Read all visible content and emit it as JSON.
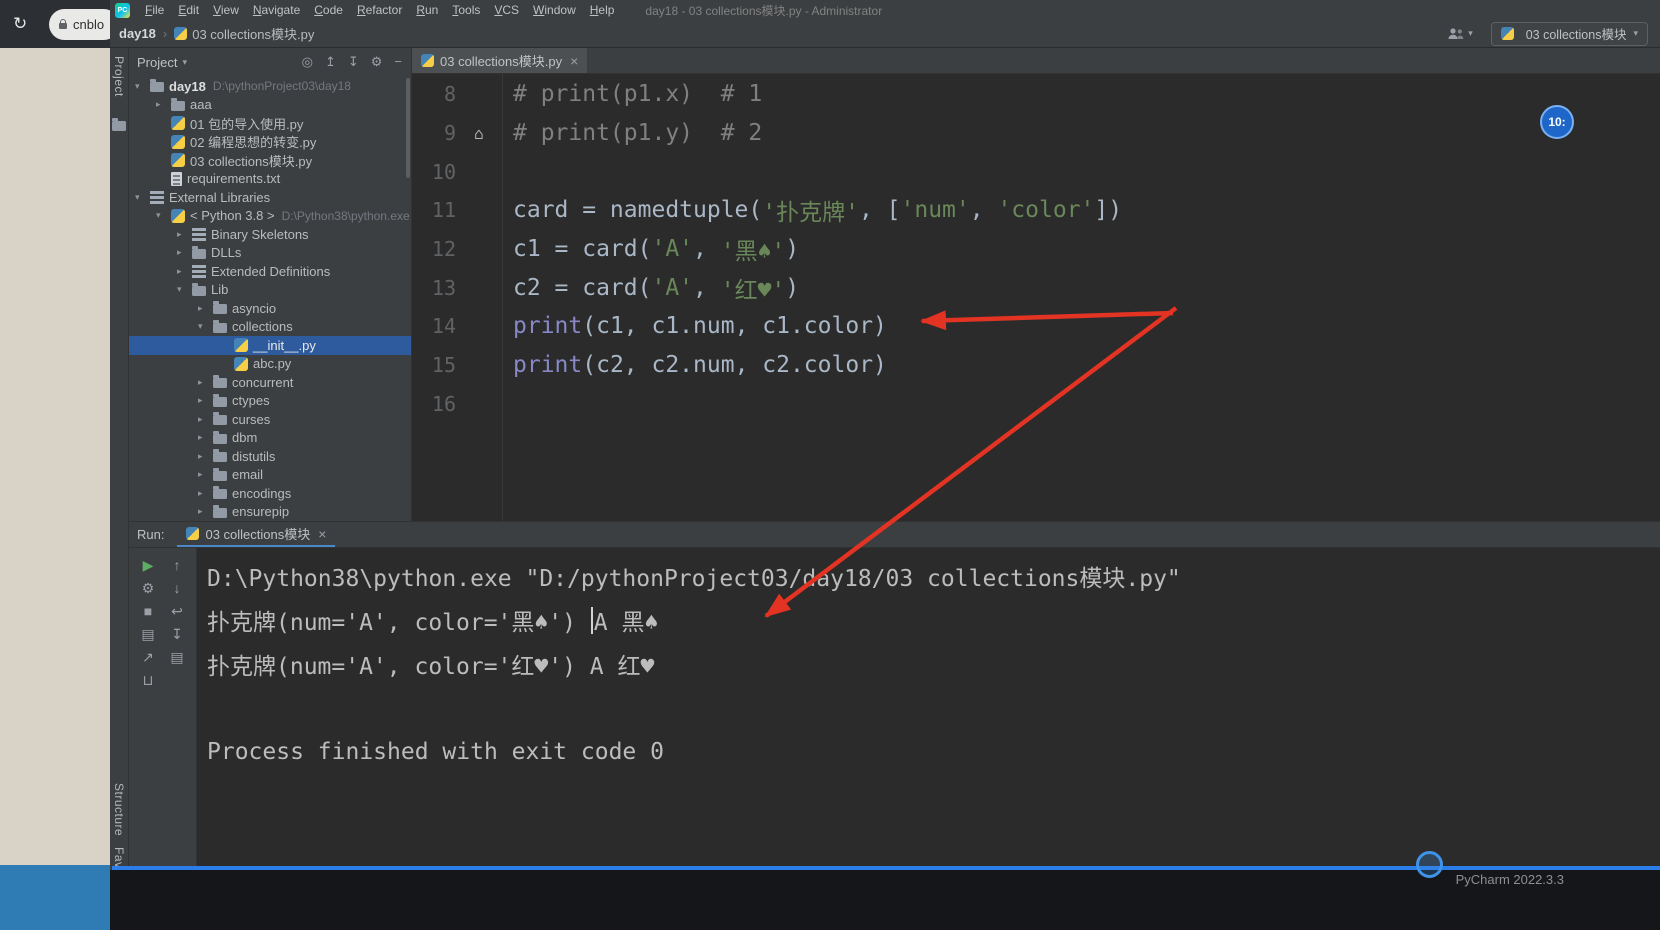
{
  "colors": {
    "editor_bg": "#2b2b2b",
    "panel_bg": "#3c3f41",
    "selection_blue": "#2d5b9e",
    "accent_blue": "#2b7de9",
    "arrow_red": "#e23323",
    "string_green": "#6a8759",
    "comment_gray": "#808080",
    "code_fg": "#a9b7c6",
    "builtin_purple": "#8888c6"
  },
  "icons": {
    "logo": "PC",
    "reload": "↻",
    "close": "×",
    "caret_down": "▾",
    "breadcrumb_separator": "›",
    "tree_open": "▾",
    "tree_closed": "▸",
    "bookmark": "⌂"
  },
  "browser": {
    "tab_text": "cnblo"
  },
  "menu_bar": {
    "items": [
      "File",
      "Edit",
      "View",
      "Navigate",
      "Code",
      "Refactor",
      "Run",
      "Tools",
      "VCS",
      "Window",
      "Help"
    ],
    "window_title": "day18 - 03 collections模块.py - Administrator"
  },
  "breadcrumb": {
    "root": "day18",
    "file": "03 collections模块.py"
  },
  "toolbar_right": {
    "run_config": "03 collections模块"
  },
  "tool_stripe": {
    "project": "Project",
    "structure": "Structure",
    "favorites": "Favorites"
  },
  "project_panel": {
    "title": "Project",
    "header_icons": [
      {
        "glyph": "◎",
        "name": "locate"
      },
      {
        "glyph": "↥",
        "name": "expand-all"
      },
      {
        "glyph": "↧",
        "name": "collapse-all"
      },
      {
        "glyph": "⚙",
        "name": "settings"
      },
      {
        "glyph": "−",
        "name": "hide-panel"
      }
    ],
    "tree": [
      {
        "label": "day18",
        "path": "D:\\pythonProject03\\day18",
        "icon": "folder",
        "arrow": "open",
        "indent": 0,
        "bold": true
      },
      {
        "label": "aaa",
        "icon": "folder",
        "arrow": "closed",
        "indent": 1
      },
      {
        "label": "01 包的导入使用.py",
        "icon": "python",
        "indent": 1
      },
      {
        "label": "02 编程思想的转变.py",
        "icon": "python",
        "indent": 1
      },
      {
        "label": "03 collections模块.py",
        "icon": "python",
        "indent": 1
      },
      {
        "label": "requirements.txt",
        "icon": "text",
        "indent": 1
      },
      {
        "label": "External Libraries",
        "icon": "lib",
        "arrow": "open",
        "indent": 0
      },
      {
        "label": "< Python 3.8 >",
        "path": "D:\\Python38\\python.exe",
        "icon": "python",
        "arrow": "open",
        "indent": 1
      },
      {
        "label": "Binary Skeletons",
        "icon": "lib",
        "arrow": "closed",
        "indent": 2
      },
      {
        "label": "DLLs",
        "icon": "folder",
        "arrow": "closed",
        "indent": 2
      },
      {
        "label": "Extended Definitions",
        "icon": "lib",
        "arrow": "closed",
        "indent": 2
      },
      {
        "label": "Lib",
        "icon": "folder",
        "arrow": "open",
        "indent": 2
      },
      {
        "label": "asyncio",
        "icon": "folder",
        "arrow": "closed",
        "indent": 3
      },
      {
        "label": "collections",
        "icon": "folder",
        "arrow": "open",
        "indent": 3
      },
      {
        "label": "__init__.py",
        "icon": "python",
        "indent": 4,
        "selected": true
      },
      {
        "label": "abc.py",
        "icon": "python",
        "indent": 4
      },
      {
        "label": "concurrent",
        "icon": "folder",
        "arrow": "closed",
        "indent": 3
      },
      {
        "label": "ctypes",
        "icon": "folder",
        "arrow": "closed",
        "indent": 3
      },
      {
        "label": "curses",
        "icon": "folder",
        "arrow": "closed",
        "indent": 3
      },
      {
        "label": "dbm",
        "icon": "folder",
        "arrow": "closed",
        "indent": 3
      },
      {
        "label": "distutils",
        "icon": "folder",
        "arrow": "closed",
        "indent": 3
      },
      {
        "label": "email",
        "icon": "folder",
        "arrow": "closed",
        "indent": 3
      },
      {
        "label": "encodings",
        "icon": "folder",
        "arrow": "closed",
        "indent": 3
      },
      {
        "label": "ensurepip",
        "icon": "folder",
        "arrow": "closed",
        "indent": 3
      }
    ]
  },
  "editor": {
    "tab": "03 collections模块.py",
    "lines": [
      {
        "n": 8,
        "segments": [
          {
            "t": "# print(p1.x)  # 1",
            "c": "comment"
          }
        ]
      },
      {
        "n": 9,
        "gutter_icon": true,
        "segments": [
          {
            "t": "# print(p1.y)  # 2",
            "c": "comment"
          }
        ]
      },
      {
        "n": 10,
        "segments": []
      },
      {
        "n": 11,
        "segments": [
          {
            "t": "card = namedtuple(",
            "c": "plain"
          },
          {
            "t": "'扑克牌'",
            "c": "string"
          },
          {
            "t": ", [",
            "c": "plain"
          },
          {
            "t": "'num'",
            "c": "string"
          },
          {
            "t": ", ",
            "c": "plain"
          },
          {
            "t": "'color'",
            "c": "string"
          },
          {
            "t": "])",
            "c": "plain"
          }
        ]
      },
      {
        "n": 12,
        "segments": [
          {
            "t": "c1 = card(",
            "c": "plain"
          },
          {
            "t": "'A'",
            "c": "string"
          },
          {
            "t": ", ",
            "c": "plain"
          },
          {
            "t": "'黑♠'",
            "c": "string"
          },
          {
            "t": ")",
            "c": "plain"
          }
        ]
      },
      {
        "n": 13,
        "segments": [
          {
            "t": "c2 = card(",
            "c": "plain"
          },
          {
            "t": "'A'",
            "c": "string"
          },
          {
            "t": ", ",
            "c": "plain"
          },
          {
            "t": "'红♥'",
            "c": "string"
          },
          {
            "t": ")",
            "c": "plain"
          }
        ]
      },
      {
        "n": 14,
        "segments": [
          {
            "t": "print",
            "c": "builtin"
          },
          {
            "t": "(c1, c1.num, c1.color)",
            "c": "plain"
          }
        ]
      },
      {
        "n": 15,
        "segments": [
          {
            "t": "print",
            "c": "builtin"
          },
          {
            "t": "(c2, c2.num, c2.color)",
            "c": "plain"
          }
        ]
      },
      {
        "n": 16,
        "segments": []
      }
    ]
  },
  "run_panel": {
    "label": "Run:",
    "tab": "03 collections模块",
    "toolbar": {
      "col1": [
        {
          "glyph": "▶",
          "name": "rerun",
          "color": "#5fad65"
        },
        {
          "glyph": "⚙",
          "name": "run-settings"
        },
        {
          "glyph": "■",
          "name": "stop"
        },
        {
          "glyph": "▤",
          "name": "restore-layout"
        },
        {
          "glyph": "↗",
          "name": "pin"
        },
        {
          "glyph": "⊔",
          "name": "clear"
        }
      ],
      "col2": [
        {
          "glyph": "↑",
          "name": "prev-occurrence"
        },
        {
          "glyph": "↓",
          "name": "next-occurrence"
        },
        {
          "glyph": "↩",
          "name": "soft-wrap"
        },
        {
          "glyph": "↧",
          "name": "scroll-to-end"
        },
        {
          "glyph": "▤",
          "name": "print-console"
        }
      ]
    },
    "output": [
      {
        "pre": "D:\\Python38\\python.exe \"D:/pythonProject03/day18/03 collections模块.py\""
      },
      {
        "pre": "扑克牌(num='A', color='黑♠') ",
        "caret": true,
        "post": "A 黑♠"
      },
      {
        "pre": "扑克牌(num='A', color='红♥') A 红♥"
      },
      {
        "pre": ""
      },
      {
        "pre": "Process finished with exit code 0"
      }
    ]
  },
  "status": {
    "version_text": "PyCharm 2022.3.3"
  },
  "overlay": {
    "badge": "10:"
  }
}
